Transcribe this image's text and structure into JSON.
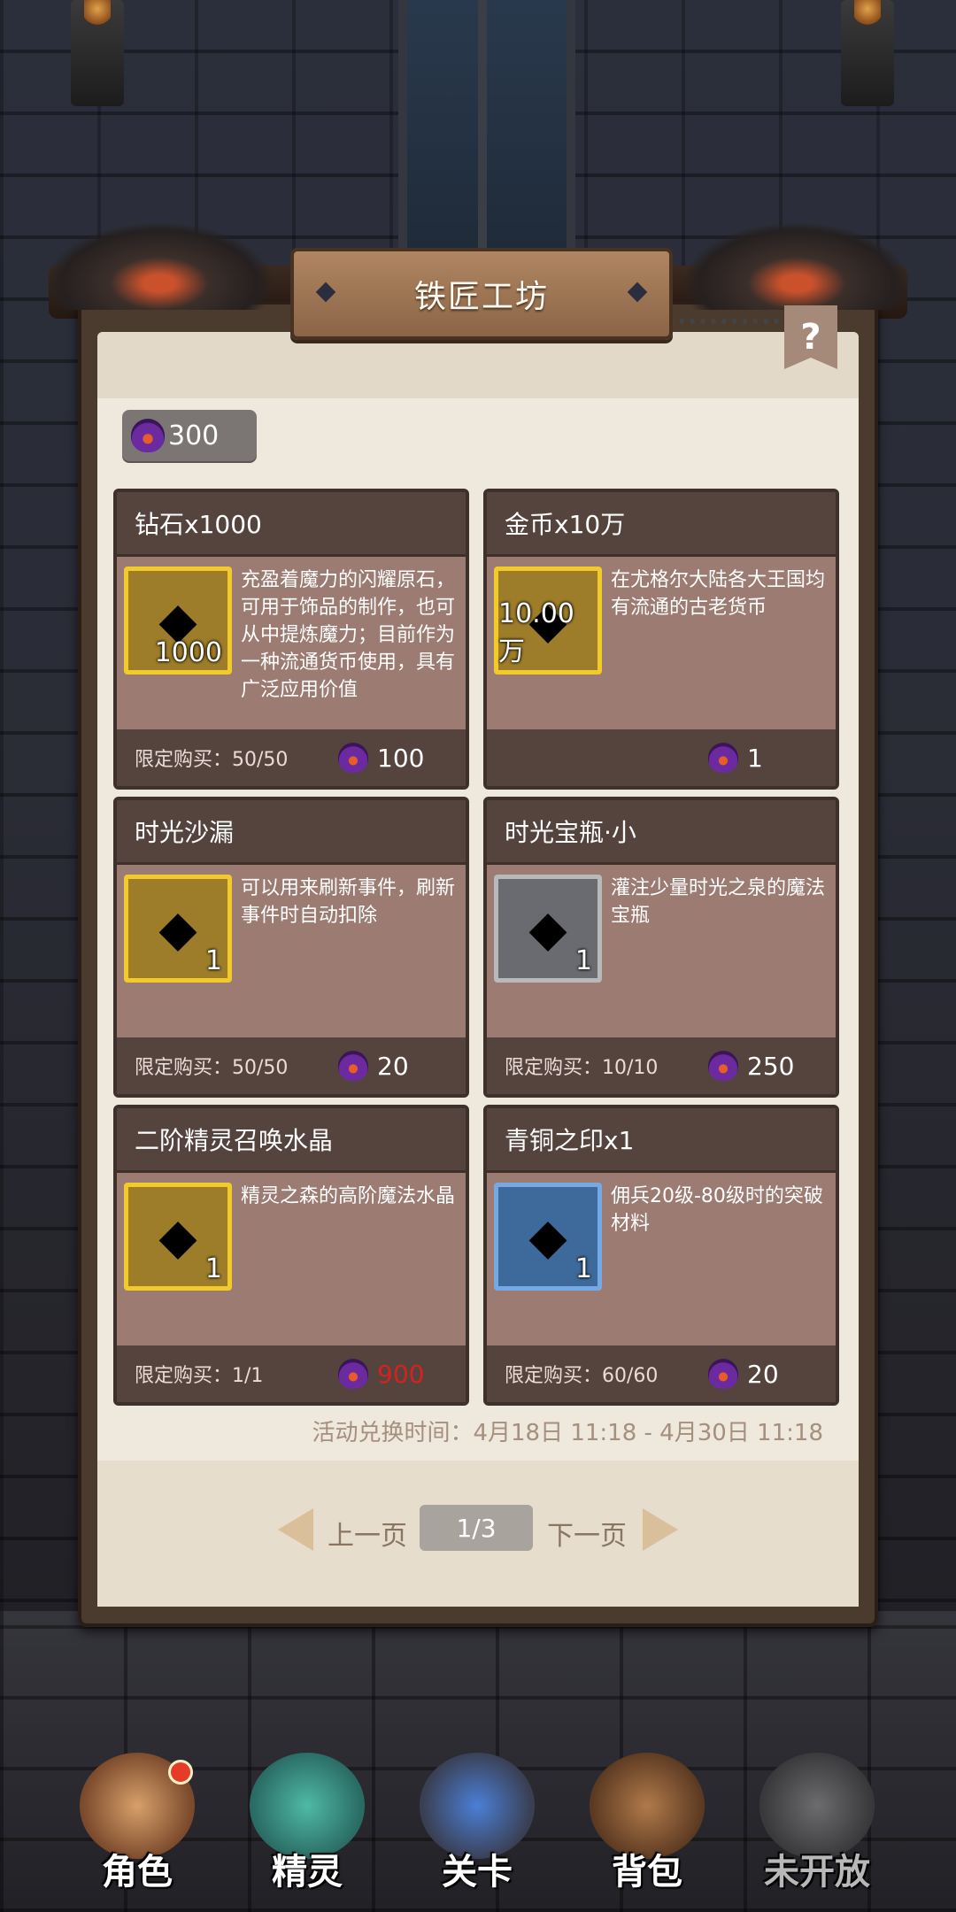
{
  "header": {
    "title": "铁匠工坊",
    "help_label": "?"
  },
  "currency": {
    "icon": "purple-flame-gem-icon",
    "amount": "300"
  },
  "cards": [
    {
      "title": "钻石x1000",
      "item_icon": "diamond-chest-icon",
      "item_count": "1000",
      "description": "充盈着魔力的闪耀原石，可用于饰品的制作，也可从中提炼魔力；目前作为一种流通货币使用，具有广泛应用价值",
      "limit": "限定购买：50/50",
      "price": "100",
      "price_color": "#ffffff"
    },
    {
      "title": "金币x10万",
      "item_icon": "gold-chest-icon",
      "item_count": "10.00万",
      "description": "在尤格尔大陆各大王国均有流通的古老货币",
      "limit": "",
      "price": "1",
      "price_color": "#ffffff"
    },
    {
      "title": "时光沙漏",
      "item_icon": "hourglass-icon",
      "item_count": "1",
      "description": "可以用来刷新事件，刷新事件时自动扣除",
      "limit": "限定购买：50/50",
      "price": "20",
      "price_color": "#ffffff"
    },
    {
      "title": "时光宝瓶·小",
      "item_icon": "potion-bottle-icon",
      "item_count": "1",
      "description": "灌注少量时光之泉的魔法宝瓶",
      "limit": "限定购买：10/10",
      "price": "250",
      "price_color": "#ffffff"
    },
    {
      "title": "二阶精灵召唤水晶",
      "item_icon": "golden-crystal-orb-icon",
      "item_count": "1",
      "description": "精灵之森的高阶魔法水晶",
      "limit": "限定购买：1/1",
      "price": "900",
      "price_color": "#d2231f"
    },
    {
      "title": "青铜之印x1",
      "item_icon": "bronze-seal-emblem-icon",
      "item_count": "1",
      "description": "佣兵20级-80级时的突破材料",
      "limit": "限定购买：60/60",
      "price": "20",
      "price_color": "#ffffff"
    }
  ],
  "event_time": "活动兑换时间：4月18日 11:18 - 4月30日 11:18",
  "pagination": {
    "prev": "上一页",
    "page": "1/3",
    "next": "下一页"
  },
  "nav": [
    {
      "label": "角色",
      "icon": "character-portrait-icon"
    },
    {
      "label": "精灵",
      "icon": "spirit-slime-icon"
    },
    {
      "label": "关卡",
      "icon": "stage-swords-icon"
    },
    {
      "label": "背包",
      "icon": "backpack-icon"
    },
    {
      "label": "未开放",
      "icon": "locked-icon"
    }
  ]
}
